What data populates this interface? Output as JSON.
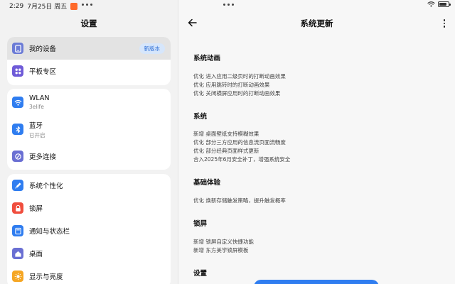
{
  "status_bar": {
    "time": "2:29",
    "date": "7月25日 周五",
    "battery_level": 0.85
  },
  "left_panel": {
    "title": "设置",
    "groups": [
      {
        "items": [
          {
            "label": "我的设备",
            "icon": "device-icon",
            "color": "#6b7bd6",
            "badge": "新版本",
            "selected": true
          },
          {
            "label": "平板专区",
            "icon": "grid-icon",
            "color": "#6f5bd8"
          }
        ]
      },
      {
        "items": [
          {
            "label": "WLAN",
            "sub": "3elife",
            "icon": "wifi-icon",
            "color": "#2f7df0"
          },
          {
            "label": "蓝牙",
            "sub": "已开启",
            "icon": "bluetooth-icon",
            "color": "#2f7df0"
          },
          {
            "label": "更多连接",
            "icon": "link-icon",
            "color": "#6a6fd3"
          }
        ]
      },
      {
        "items": [
          {
            "label": "系统个性化",
            "icon": "brush-icon",
            "color": "#2f7df0"
          },
          {
            "label": "锁屏",
            "icon": "lock-icon",
            "color": "#f04e3e"
          },
          {
            "label": "通知与状态栏",
            "icon": "notification-icon",
            "color": "#2f7df0"
          },
          {
            "label": "桌面",
            "icon": "home-icon",
            "color": "#6a6fd3"
          },
          {
            "label": "显示与亮度",
            "icon": "sun-icon",
            "color": "#f5a623"
          }
        ]
      }
    ]
  },
  "right_panel": {
    "title": "系统更新",
    "sections": [
      {
        "heading": "系统动画",
        "lines": [
          "优化 进入应用二级页时的打断动画效果",
          "优化 应用跳转时的打断动画效果",
          "优化 关闭横屏应用时的打断动画效果"
        ]
      },
      {
        "heading": "系统",
        "lines": [
          "新增 桌面壁纸支持模糊效果",
          "优化 部分三方应用的信息流页面流畅度",
          "优化 部分经典页面样式更新",
          "合入2025年6月安全补丁，增强系统安全"
        ]
      },
      {
        "heading": "基础体验",
        "lines": [
          "优化 焕新存储触发策略，提升触发概率"
        ]
      },
      {
        "heading": "锁屏",
        "lines": [
          "新增 锁屏自定义快捷功能",
          "新增 东方美学锁屏模板"
        ]
      },
      {
        "heading": "设置",
        "lines": []
      }
    ],
    "update_button_color": "#2f7df0"
  }
}
